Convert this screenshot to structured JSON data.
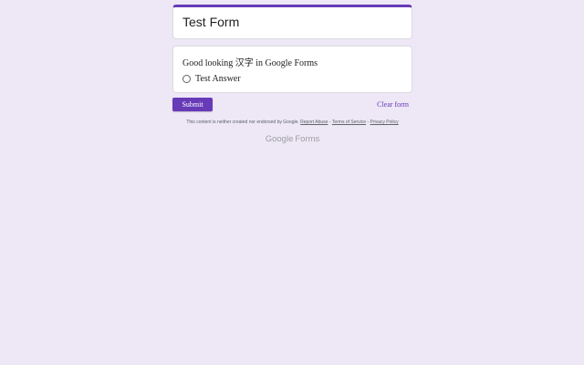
{
  "header": {
    "form_title": "Test Form"
  },
  "question": {
    "text": "Good looking 汉字 in Google Forms",
    "options": [
      {
        "label": "Test Answer",
        "selected": false
      }
    ]
  },
  "actions": {
    "submit_label": "Submit",
    "clear_label": "Clear form"
  },
  "footer": {
    "disclaimer": "This content is neither created nor endorsed by Google.",
    "report_abuse": "Report Abuse",
    "sep1": " - ",
    "terms": "Terms of Service",
    "sep2": " - ",
    "privacy": "Privacy Policy"
  },
  "brand": {
    "google": "Google",
    "forms": "Forms"
  },
  "colors": {
    "accent": "#673ab7",
    "background": "#ede7f6",
    "card": "#ffffff",
    "text": "#202124"
  }
}
